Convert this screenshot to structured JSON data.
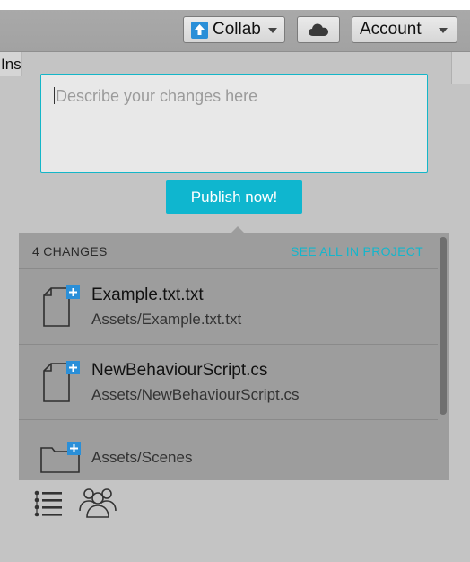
{
  "toolbar": {
    "collab_label": "Collab",
    "account_label": "Account"
  },
  "inspector_tab": {
    "label": "Inspector"
  },
  "commit": {
    "placeholder": "Describe your changes here",
    "publish_label": "Publish now!"
  },
  "changes": {
    "count_label": "4 CHANGES",
    "see_all_label": "SEE ALL IN PROJECT",
    "items": [
      {
        "name": "Example.txt.txt",
        "path": "Assets/Example.txt.txt",
        "icon": "file-added-icon"
      },
      {
        "name": "NewBehaviourScript.cs",
        "path": "Assets/NewBehaviourScript.cs",
        "icon": "file-added-icon"
      },
      {
        "name": "",
        "path": "Assets/Scenes",
        "icon": "folder-added-icon"
      }
    ]
  },
  "colors": {
    "accent": "#0fb6cf",
    "panel": "#9d9d9d",
    "background": "#c4c4c4",
    "added_badge": "#2a8fd8"
  },
  "bottom_icons": [
    "history-icon",
    "collaborators-icon"
  ]
}
